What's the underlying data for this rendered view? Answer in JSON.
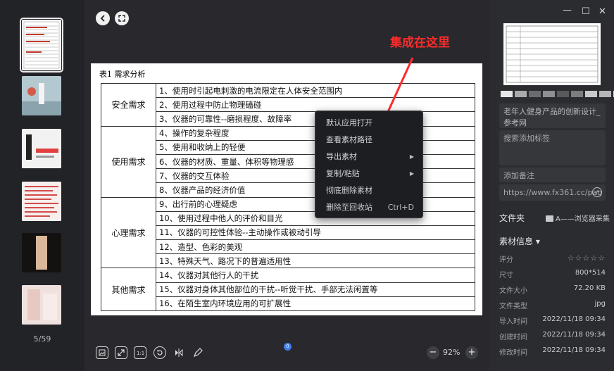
{
  "thumbnails": {
    "counter": "5/59"
  },
  "viewer": {
    "annotation": "集成在这里",
    "document": {
      "title": "表1 需求分析",
      "groups": [
        {
          "category": "安全需求",
          "items": [
            "1、使用时引起电刺激的电流限定在人体安全范围内",
            "2、使用过程中防止物理磕碰",
            "3、仪器的可靠性--磨损程度、故障率"
          ]
        },
        {
          "category": "使用需求",
          "items": [
            "4、操作的复杂程度",
            "5、使用和收纳上的轻便",
            "6、仪器的材质、重量、体积等物理感",
            "7、仪器的交互体验",
            "8、仪器产品的经济价值"
          ]
        },
        {
          "category": "心理需求",
          "items": [
            "9、出行前的心理疑虑",
            "10、使用过程中他人的评价和目光",
            "11、仪器的可控性体验--主动操作或被动引导",
            "12、造型、色彩的美观",
            "13、特殊天气、路况下的普遍适用性"
          ]
        },
        {
          "category": "其他需求",
          "items": [
            "14、仪器对其他行人的干扰",
            "15、仪器对身体其他部位的干扰--听觉干扰、手部无法闲置等",
            "16、在陌生室内环境应用的可扩展性"
          ]
        }
      ]
    },
    "context_menu": [
      {
        "label": "默认应用打开"
      },
      {
        "label": "查看素材路径"
      },
      {
        "label": "导出素材",
        "submenu": true
      },
      {
        "label": "复制/粘贴",
        "submenu": true
      },
      {
        "label": "彻底删除素材"
      },
      {
        "label": "删除至回收站",
        "shortcut": "Ctrl+D"
      }
    ],
    "toolbar": {
      "badge": "0",
      "zoom": "92%",
      "zoom_out": "−",
      "zoom_in": "+"
    }
  },
  "panel": {
    "title": "老年人健身产品的创新设计_参考网",
    "tag_placeholder": "搜索添加标签",
    "note_placeholder": "添加备注",
    "url": "https://www.fx361.cc/pag",
    "folder_label": "文件夹",
    "folder_value": "A——浏览器采集",
    "info_header": "素材信息 ▾",
    "swatches": [
      "#e6e6e6",
      "#a9aaac",
      "#6b6c6e",
      "#8e8f91",
      "#595a5c",
      "#7c7d7f",
      "#c9cacb",
      "#b5b6b7",
      "#d7d8d9"
    ],
    "info": [
      {
        "label": "评分",
        "value": "☆☆☆☆☆"
      },
      {
        "label": "尺寸",
        "value": "800*514"
      },
      {
        "label": "文件大小",
        "value": "72.20 KB"
      },
      {
        "label": "文件类型",
        "value": "jpg"
      },
      {
        "label": "导入时间",
        "value": "2022/11/18 09:34"
      },
      {
        "label": "创建时间",
        "value": "2022/11/18 09:34"
      },
      {
        "label": "修改时间",
        "value": "2022/11/18 09:34"
      }
    ]
  }
}
